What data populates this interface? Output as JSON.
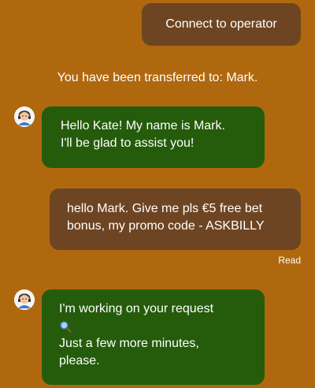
{
  "header": {
    "connect_label": "Connect to operator"
  },
  "system": {
    "transfer_text": "You have been transferred to: Mark."
  },
  "messages": [
    {
      "sender": "operator",
      "lines": [
        "Hello Kate! My name is Mark.",
        "I'll be glad to assist you!"
      ]
    },
    {
      "sender": "user",
      "lines": [
        "hello Mark. Give me pls €5 free bet",
        "bonus, my promo code - ASKBILLY"
      ],
      "status": "Read"
    },
    {
      "sender": "operator",
      "lines": [
        "I'm working on your request",
        "Just a few more minutes,",
        "please."
      ],
      "icon": "magnifier-icon"
    }
  ],
  "colors": {
    "background": "#b0680f",
    "user_bubble": "#6e4522",
    "operator_bubble": "#245c0b",
    "text": "#ffffff"
  }
}
